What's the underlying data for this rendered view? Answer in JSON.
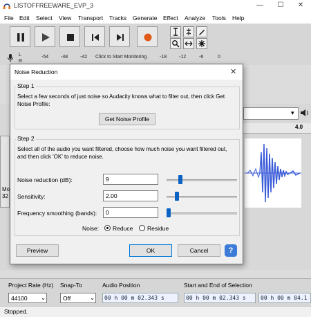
{
  "window": {
    "title": "LISTOFFREEWARE_EVP_3",
    "controls": {
      "minimize": "—",
      "maximize": "☐",
      "close": "✕"
    }
  },
  "menu": [
    "File",
    "Edit",
    "Select",
    "View",
    "Transport",
    "Tracks",
    "Generate",
    "Effect",
    "Analyze",
    "Tools",
    "Help"
  ],
  "meter": {
    "channel_l": "L",
    "channel_r": "R",
    "ticks_left": [
      "-54",
      "-48",
      "-42"
    ],
    "monitor_label": "Click to Start Monitoring",
    "ticks_right": [
      "-18",
      "-12",
      "-6",
      "0"
    ]
  },
  "ruler": {
    "right_label": "4.0"
  },
  "track_left_fragments": {
    "line1": "Mo",
    "line2": "32"
  },
  "dialog": {
    "title": "Noise Reduction",
    "close": "✕",
    "step1": {
      "label": "Step 1",
      "text": "Select a few seconds of just noise so Audacity knows what to filter out, then click Get Noise Profile:",
      "button": "Get Noise Profile"
    },
    "step2": {
      "label": "Step 2",
      "text": "Select all of the audio you want filtered, choose how much noise you want filtered out, and then click 'OK' to reduce noise.",
      "params": [
        {
          "label": "Noise reduction (dB):",
          "value": "9",
          "slider": 0.18
        },
        {
          "label": "Sensitivity:",
          "value": "2.00",
          "slider": 0.12
        },
        {
          "label": "Frequency smoothing (bands):",
          "value": "0",
          "slider": 0.0
        }
      ],
      "noise_label": "Noise:",
      "noise_options": [
        "Reduce",
        "Residue"
      ],
      "noise_selected": "Reduce"
    },
    "buttons": {
      "preview": "Preview",
      "ok": "OK",
      "cancel": "Cancel",
      "help": "?"
    }
  },
  "bottom": {
    "project_rate_label": "Project Rate (Hz)",
    "project_rate_value": "44100",
    "snap_label": "Snap-To",
    "snap_value": "Off",
    "audio_position_label": "Audio Position",
    "audio_position_value": "00 h 00 m 02.343 s",
    "selection_label": "Start and End of Selection",
    "selection_start": "00 h 00 m 02.343 s",
    "selection_end": "00 h 00 m 04.1"
  },
  "status": "Stopped.",
  "colors": {
    "accent": "#0a63c4",
    "record": "#e05a1a",
    "waveform": "#3a5bd8"
  }
}
